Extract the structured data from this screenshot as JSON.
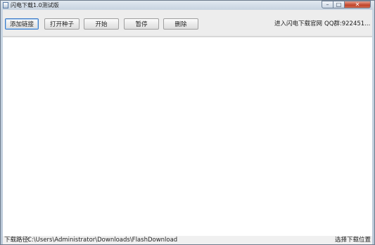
{
  "window": {
    "title": "闪电下载1.0测试版",
    "controls": {
      "minimize": "–",
      "maximize": "□",
      "close": "✕"
    }
  },
  "toolbar": {
    "buttons": [
      "添加链接",
      "打开种子",
      "开始",
      "暂停",
      "删除"
    ],
    "links": {
      "official_site": "进入闪电下载官网",
      "qq_group": "QQ群:922451..."
    }
  },
  "statusbar": {
    "path_label": "下载路径:",
    "path_value": "C:\\Users\\Administrator\\Downloads\\FlashDownload",
    "choose_button": "选择下载位置"
  },
  "colors": {
    "accent_border": "#3d7bc7",
    "close_button": "#c0442a"
  }
}
